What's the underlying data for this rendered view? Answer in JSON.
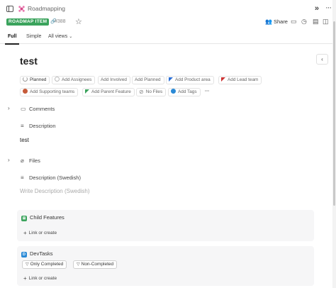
{
  "header": {
    "app_name": "Roadmapping",
    "badge": "ROADMAP ITEM",
    "item_id": "#388",
    "share_label": "Share"
  },
  "tabs": [
    {
      "label": "Full"
    },
    {
      "label": "Simple"
    },
    {
      "label": "All views"
    }
  ],
  "item": {
    "title": "test",
    "chips": [
      {
        "label": "Planned"
      },
      {
        "label": "Add Assignees"
      },
      {
        "label": "Add Involved"
      },
      {
        "label": "Add Planned"
      },
      {
        "label": "Add Product area"
      },
      {
        "label": "Add Lead team"
      },
      {
        "label": "Add Supporting teams"
      },
      {
        "label": "Add Parent Feature"
      },
      {
        "label": "No Files"
      },
      {
        "label": "Add Tags"
      },
      {
        "label": "···"
      }
    ]
  },
  "sections": {
    "comments": "Comments",
    "description": "Description",
    "description_text": "test",
    "files": "Files",
    "description_swedish": "Description (Swedish)",
    "swedish_placeholder": "Write Description (Swedish)"
  },
  "panels": {
    "child_features": {
      "title": "Child Features",
      "link": "Link or create"
    },
    "devtasks": {
      "title": "DevTasks",
      "filter_completed": "Only Completed",
      "filter_non_completed": "Non-Completed",
      "link": "Link or create"
    }
  },
  "colors": {
    "badge": "#3aa35c",
    "child_features_icon": "#3aa35c",
    "devtasks_icon": "#2b8ad6"
  }
}
